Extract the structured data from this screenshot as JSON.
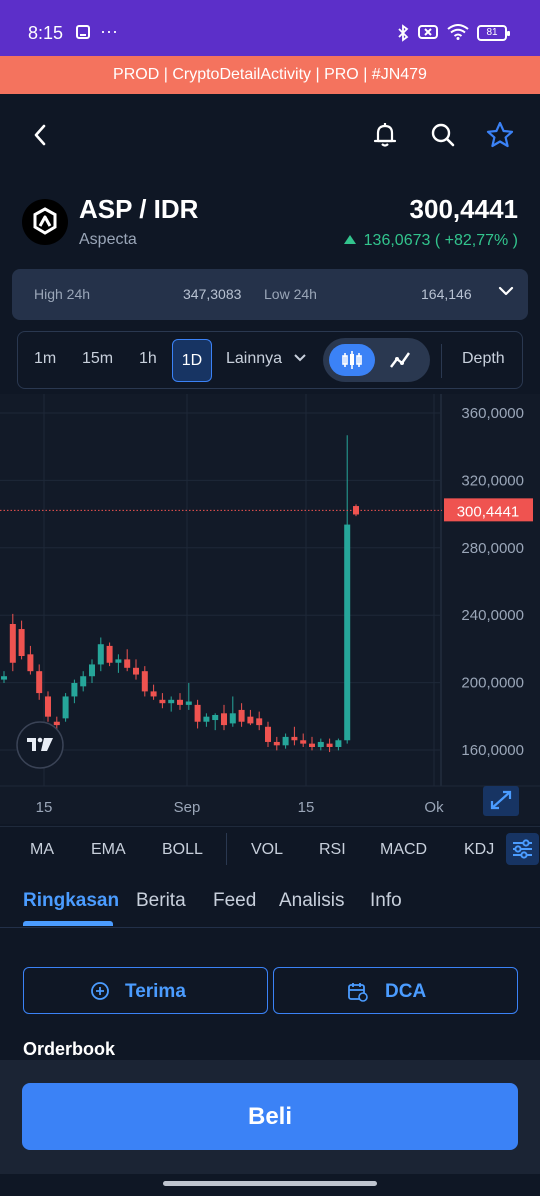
{
  "status_bar": {
    "time": "8:15",
    "battery": "81"
  },
  "env_banner": "PROD | CryptoDetailActivity | PRO | #JN479",
  "asset": {
    "pair": "ASP / IDR",
    "name": "Aspecta",
    "price": "300,4441",
    "change": "136,0673 ( +82,77% )",
    "change_color": "#32c48d"
  },
  "stats": {
    "high_label": "High 24h",
    "high_value": "347,3083",
    "low_label": "Low 24h",
    "low_value": "164,146"
  },
  "timeframes": {
    "items": [
      "1m",
      "15m",
      "1h",
      "1D"
    ],
    "active": "1D",
    "more_label": "Lainnya",
    "depth_label": "Depth"
  },
  "chart_data": {
    "type": "candlestick",
    "y_ticks": [
      "360,0000",
      "320,0000",
      "280,0000",
      "240,0000",
      "200,0000",
      "160,0000"
    ],
    "x_ticks": [
      "15",
      "Sep",
      "15",
      "Ok"
    ],
    "last_price_label": "300,4441",
    "up_color": "#26a69a",
    "down_color": "#ef5350",
    "candles": [
      {
        "o": 200,
        "h": 205,
        "l": 198,
        "c": 202
      },
      {
        "o": 233,
        "h": 239,
        "l": 205,
        "c": 210
      },
      {
        "o": 230,
        "h": 235,
        "l": 212,
        "c": 214
      },
      {
        "o": 215,
        "h": 220,
        "l": 203,
        "c": 205
      },
      {
        "o": 205,
        "h": 209,
        "l": 188,
        "c": 192
      },
      {
        "o": 190,
        "h": 193,
        "l": 175,
        "c": 178
      },
      {
        "o": 175,
        "h": 178,
        "l": 170,
        "c": 173
      },
      {
        "o": 177,
        "h": 192,
        "l": 175,
        "c": 190
      },
      {
        "o": 190,
        "h": 200,
        "l": 186,
        "c": 198
      },
      {
        "o": 196,
        "h": 205,
        "l": 193,
        "c": 202
      },
      {
        "o": 202,
        "h": 212,
        "l": 198,
        "c": 209
      },
      {
        "o": 209,
        "h": 225,
        "l": 205,
        "c": 221
      },
      {
        "o": 220,
        "h": 222,
        "l": 208,
        "c": 210
      },
      {
        "o": 210,
        "h": 215,
        "l": 204,
        "c": 212
      },
      {
        "o": 212,
        "h": 218,
        "l": 205,
        "c": 207
      },
      {
        "o": 207,
        "h": 212,
        "l": 200,
        "c": 203
      },
      {
        "o": 205,
        "h": 208,
        "l": 190,
        "c": 193
      },
      {
        "o": 193,
        "h": 197,
        "l": 188,
        "c": 190
      },
      {
        "o": 188,
        "h": 192,
        "l": 183,
        "c": 186
      },
      {
        "o": 186,
        "h": 190,
        "l": 181,
        "c": 188
      },
      {
        "o": 188,
        "h": 192,
        "l": 182,
        "c": 185
      },
      {
        "o": 185,
        "h": 198,
        "l": 182,
        "c": 187
      },
      {
        "o": 185,
        "h": 188,
        "l": 171,
        "c": 175
      },
      {
        "o": 175,
        "h": 180,
        "l": 172,
        "c": 178
      },
      {
        "o": 176,
        "h": 180,
        "l": 170,
        "c": 179
      },
      {
        "o": 180,
        "h": 185,
        "l": 170,
        "c": 173
      },
      {
        "o": 174,
        "h": 190,
        "l": 172,
        "c": 180
      },
      {
        "o": 182,
        "h": 186,
        "l": 172,
        "c": 175
      },
      {
        "o": 178,
        "h": 182,
        "l": 173,
        "c": 174
      },
      {
        "o": 177,
        "h": 181,
        "l": 170,
        "c": 173
      },
      {
        "o": 172,
        "h": 175,
        "l": 160,
        "c": 163
      },
      {
        "o": 163,
        "h": 166,
        "l": 158,
        "c": 161
      },
      {
        "o": 161,
        "h": 168,
        "l": 159,
        "c": 166
      },
      {
        "o": 166,
        "h": 172,
        "l": 161,
        "c": 164
      },
      {
        "o": 164,
        "h": 168,
        "l": 160,
        "c": 162
      },
      {
        "o": 162,
        "h": 166,
        "l": 158,
        "c": 160
      },
      {
        "o": 160,
        "h": 165,
        "l": 158,
        "c": 163
      },
      {
        "o": 162,
        "h": 165,
        "l": 157,
        "c": 160
      },
      {
        "o": 160,
        "h": 165,
        "l": 158,
        "c": 164
      },
      {
        "o": 164,
        "h": 345,
        "l": 162,
        "c": 292
      },
      {
        "o": 303,
        "h": 304,
        "l": 297,
        "c": 298
      }
    ]
  },
  "indicators": [
    "MA",
    "EMA",
    "BOLL",
    "VOL",
    "RSI",
    "MACD",
    "KDJ"
  ],
  "tabs": {
    "items": [
      "Ringkasan",
      "Berita",
      "Feed",
      "Analisis",
      "Info"
    ],
    "active": "Ringkasan"
  },
  "actions": {
    "receive": "Terima",
    "dca": "DCA"
  },
  "orderbook_title": "Orderbook",
  "buy_label": "Beli"
}
